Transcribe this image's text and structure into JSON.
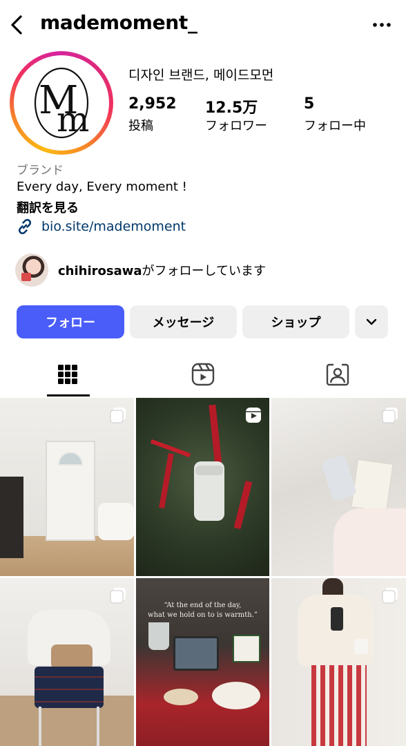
{
  "header": {
    "username": "mademoment_",
    "back_icon": "chevron-left-icon",
    "more_icon": "more-horizontal-icon"
  },
  "profile": {
    "display_name": "디자인 브랜드, 메이드모먼",
    "stats": {
      "posts_value": "2,952",
      "posts_label": "投稿",
      "followers_value": "12.5万",
      "followers_label": "フォロワー",
      "following_value": "5",
      "following_label": "フォロー中"
    },
    "category": "ブランド",
    "bio": "Every day, Every moment !",
    "translate": "翻訳を見る",
    "link": "bio.site/mademoment",
    "followed_by_user": "chihirosawa",
    "followed_by_suffix": "がフォローしています",
    "story_ring_colors": [
      "#fdb913",
      "#f58529",
      "#dd2a7b"
    ]
  },
  "actions": {
    "follow": "フォロー",
    "message": "メッセージ",
    "shop": "ショップ",
    "follow_color": "#4a5df9"
  },
  "tabs": {
    "items": [
      "grid-icon",
      "reels-icon",
      "tagged-icon"
    ],
    "active": "grid-icon"
  },
  "posts": {
    "caption_5_line1": "“At the end of the day,",
    "caption_5_line2": "what we hold on to is warmth.”"
  }
}
